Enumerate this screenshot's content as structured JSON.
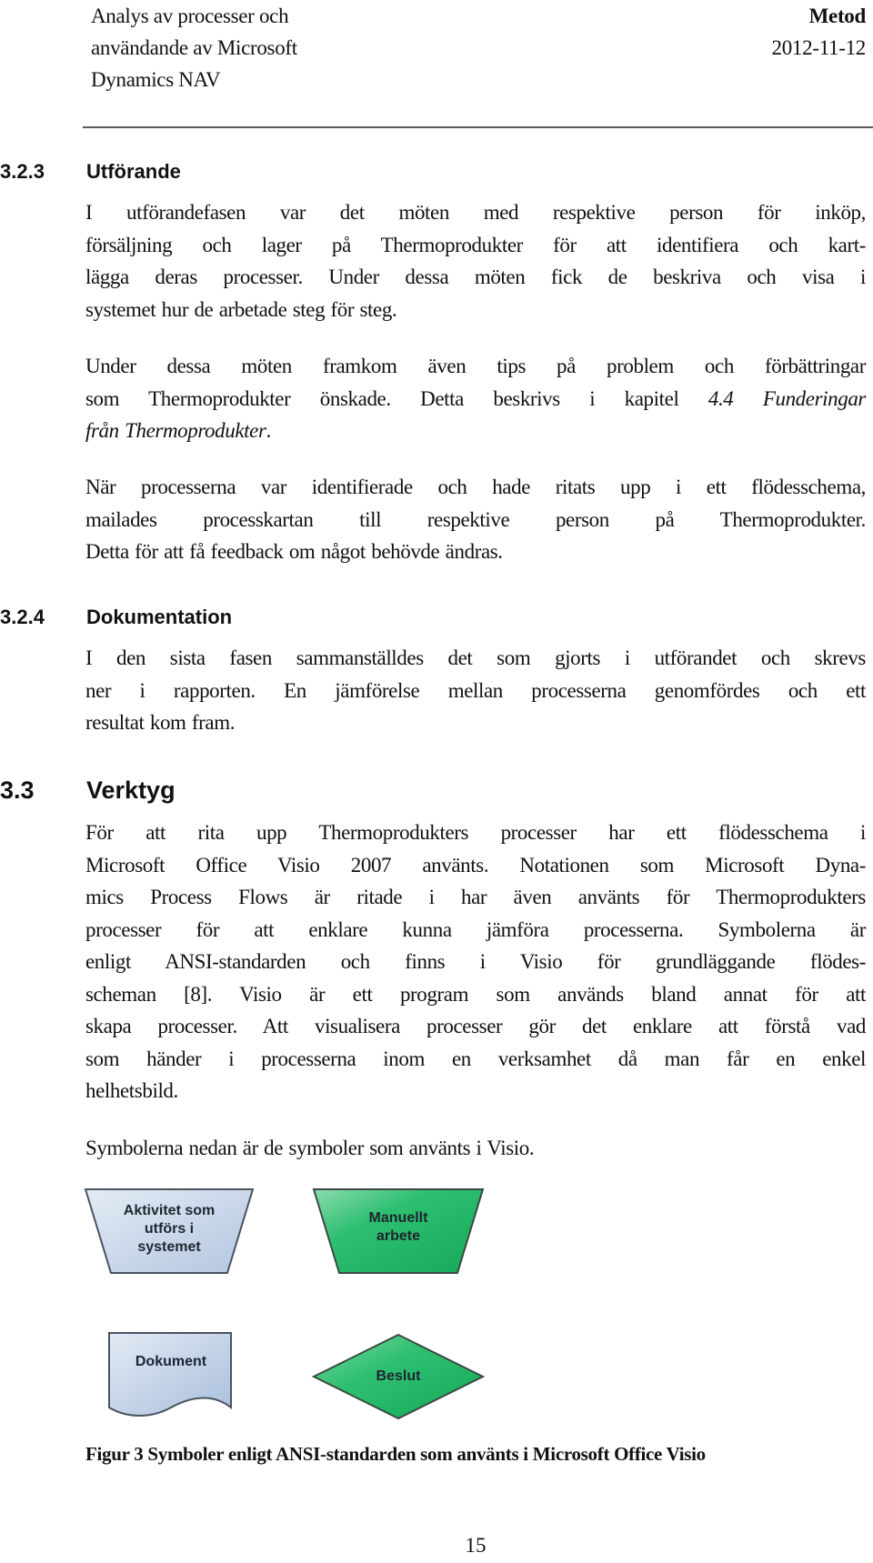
{
  "header": {
    "title_lines": [
      "Analys av processer och",
      "användande av Microsoft",
      "Dynamics NAV"
    ],
    "section": "Metod",
    "date": "2012-11-12"
  },
  "sections": {
    "s323": {
      "number": "3.2.3",
      "title": "Utförande",
      "p1_lines": [
        "I utförandefasen var det möten med respektive person för inköp,",
        "försäljning och lager på Thermoprodukter för att identifiera och kart-",
        "lägga deras processer. Under dessa möten fick de beskriva och visa i",
        "systemet hur de arbetade steg för steg."
      ],
      "p2_line1": "Under dessa möten framkom även tips på problem och förbättringar",
      "p2_line2_plain": "som Thermoprodukter önskade. Detta beskrivs i kapitel ",
      "p2_line2_italic": "4.4 Funderingar",
      "p2_line3_italic": "från Thermoprodukter",
      "p2_line3_end": ".",
      "p3_lines": [
        "När processerna var identifierade och hade ritats upp i ett flödesschema,",
        "mailades processkartan till respektive person på Thermoprodukter.",
        "Detta för att få feedback om något behövde ändras."
      ]
    },
    "s324": {
      "number": "3.2.4",
      "title": "Dokumentation",
      "p1_lines": [
        "I den sista fasen sammanställdes det som gjorts i utförandet och skrevs",
        "ner i rapporten. En jämförelse mellan processerna genomfördes och ett",
        "resultat kom fram."
      ]
    },
    "s33": {
      "number": "3.3",
      "title": "Verktyg",
      "p1_lines": [
        "För att rita upp Thermoprodukters processer har ett flödesschema i",
        "Microsoft Office Visio 2007 använts. Notationen som Microsoft Dyna-",
        "mics Process Flows är ritade i har även använts för Thermoprodukters",
        "processer för att enklare kunna jämföra processerna. Symbolerna är",
        "enligt ANSI-standarden och finns i Visio för grundläggande flödes-",
        "scheman [8]. Visio är ett program som används bland annat för att",
        "skapa processer. Att visualisera processer gör det enklare att förstå vad",
        "som händer i processerna inom en verksamhet då man får en enkel",
        "helhetsbild."
      ],
      "p2": "Symbolerna nedan är de symboler som använts i Visio."
    }
  },
  "figure": {
    "symbols": [
      {
        "name": "system-activity",
        "shape": "trapezoid",
        "label_lines": [
          "Aktivitet som",
          "utförs i",
          "systemet"
        ],
        "color": "#c5d3e6"
      },
      {
        "name": "manual-work",
        "shape": "trapezoid",
        "label_lines": [
          "Manuellt",
          "arbete"
        ],
        "color": "#22b466"
      },
      {
        "name": "document",
        "shape": "document",
        "label_lines": [
          "Dokument"
        ],
        "color": "#c0d0e4"
      },
      {
        "name": "decision",
        "shape": "diamond",
        "label_lines": [
          "Beslut"
        ],
        "color": "#22b466"
      }
    ],
    "caption": "Figur 3 Symboler enligt ANSI-standarden som använts i Microsoft Office Visio"
  },
  "footer": {
    "page_number": "15"
  }
}
